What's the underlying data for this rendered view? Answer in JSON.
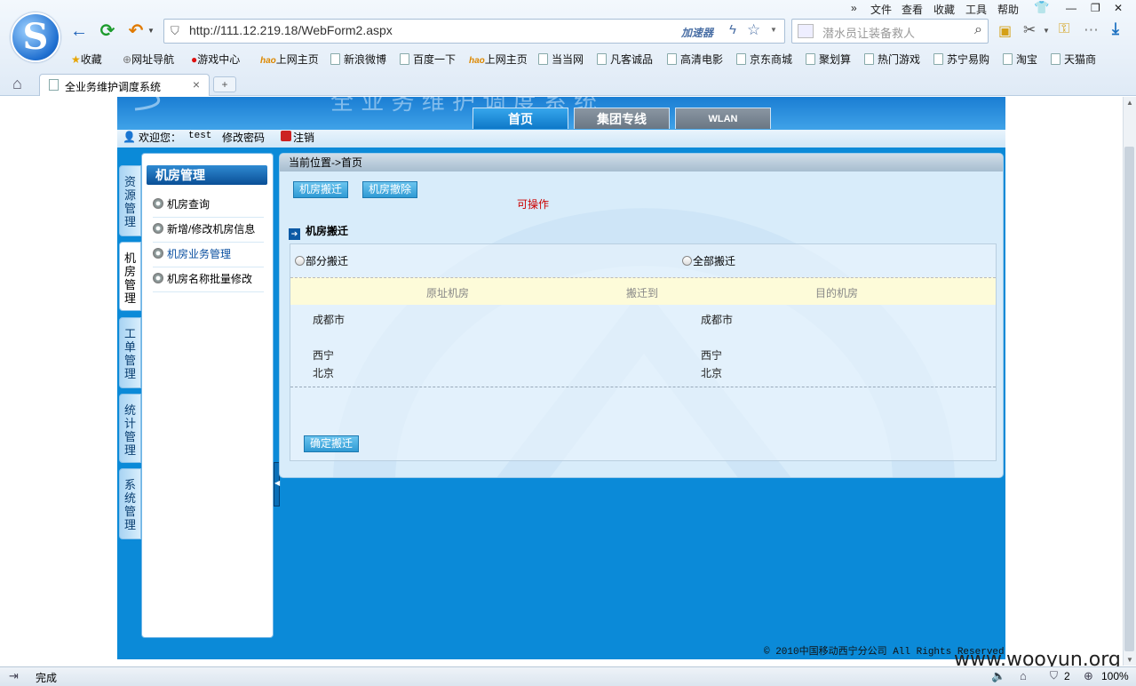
{
  "browser": {
    "menu": [
      "文件",
      "查看",
      "收藏",
      "工具",
      "帮助"
    ],
    "menu_more": "»",
    "url": "http://111.12.219.18/WebForm2.aspx",
    "accelerator": "加速器",
    "search_placeholder": "潜水员让装备救人",
    "bookmarks": [
      "收藏",
      "网址导航",
      "游戏中心",
      "上网主页",
      "新浪微博",
      "百度一下",
      "上网主页",
      "当当网",
      "凡客诚品",
      "高清电影",
      "京东商城",
      "聚划算",
      "热门游戏",
      "苏宁易购",
      "淘宝",
      "天猫商"
    ],
    "tab_title": "全业务维护调度系统",
    "tab_close": "×",
    "new_tab": "+",
    "status": "完成",
    "status_count": "2",
    "zoom": "100%"
  },
  "site": {
    "nav_tabs": [
      "首页",
      "集团专线",
      "WLAN"
    ],
    "welcome": "欢迎您：",
    "user": "test",
    "change_password": "修改密码",
    "logout": "注销",
    "vertical_tabs": [
      "资源管理",
      "机房管理",
      "工单管理",
      "统计管理",
      "系统管理"
    ],
    "left_title": "机房管理",
    "left_items": [
      "机房查询",
      "新增/修改机房信息",
      "机房业务管理",
      "机房名称批量修改"
    ],
    "breadcrumb": "当前位置->首页",
    "btn_move": "机房搬迁",
    "btn_delete": "机房撤除",
    "operable": "可操作",
    "section_title": "机房搬迁",
    "radio_partial": "部分搬迁",
    "radio_all": "全部搬迁",
    "table_headers": [
      "原址机房",
      "搬迁到",
      "目的机房"
    ],
    "rows_left": [
      "成都市",
      "西宁",
      "北京"
    ],
    "rows_right": [
      "成都市",
      "西宁",
      "北京"
    ],
    "confirm": "确定搬迁",
    "footer": "© 2010中国移动西宁分公司 All Rights Reserved",
    "watermark": "www.wooyun.org"
  },
  "colors": {
    "site_bg": "#0b8ad8",
    "panel_bg": "#d8ecfa",
    "operable_text": "#cc0000",
    "button": "#2f9ad4"
  }
}
